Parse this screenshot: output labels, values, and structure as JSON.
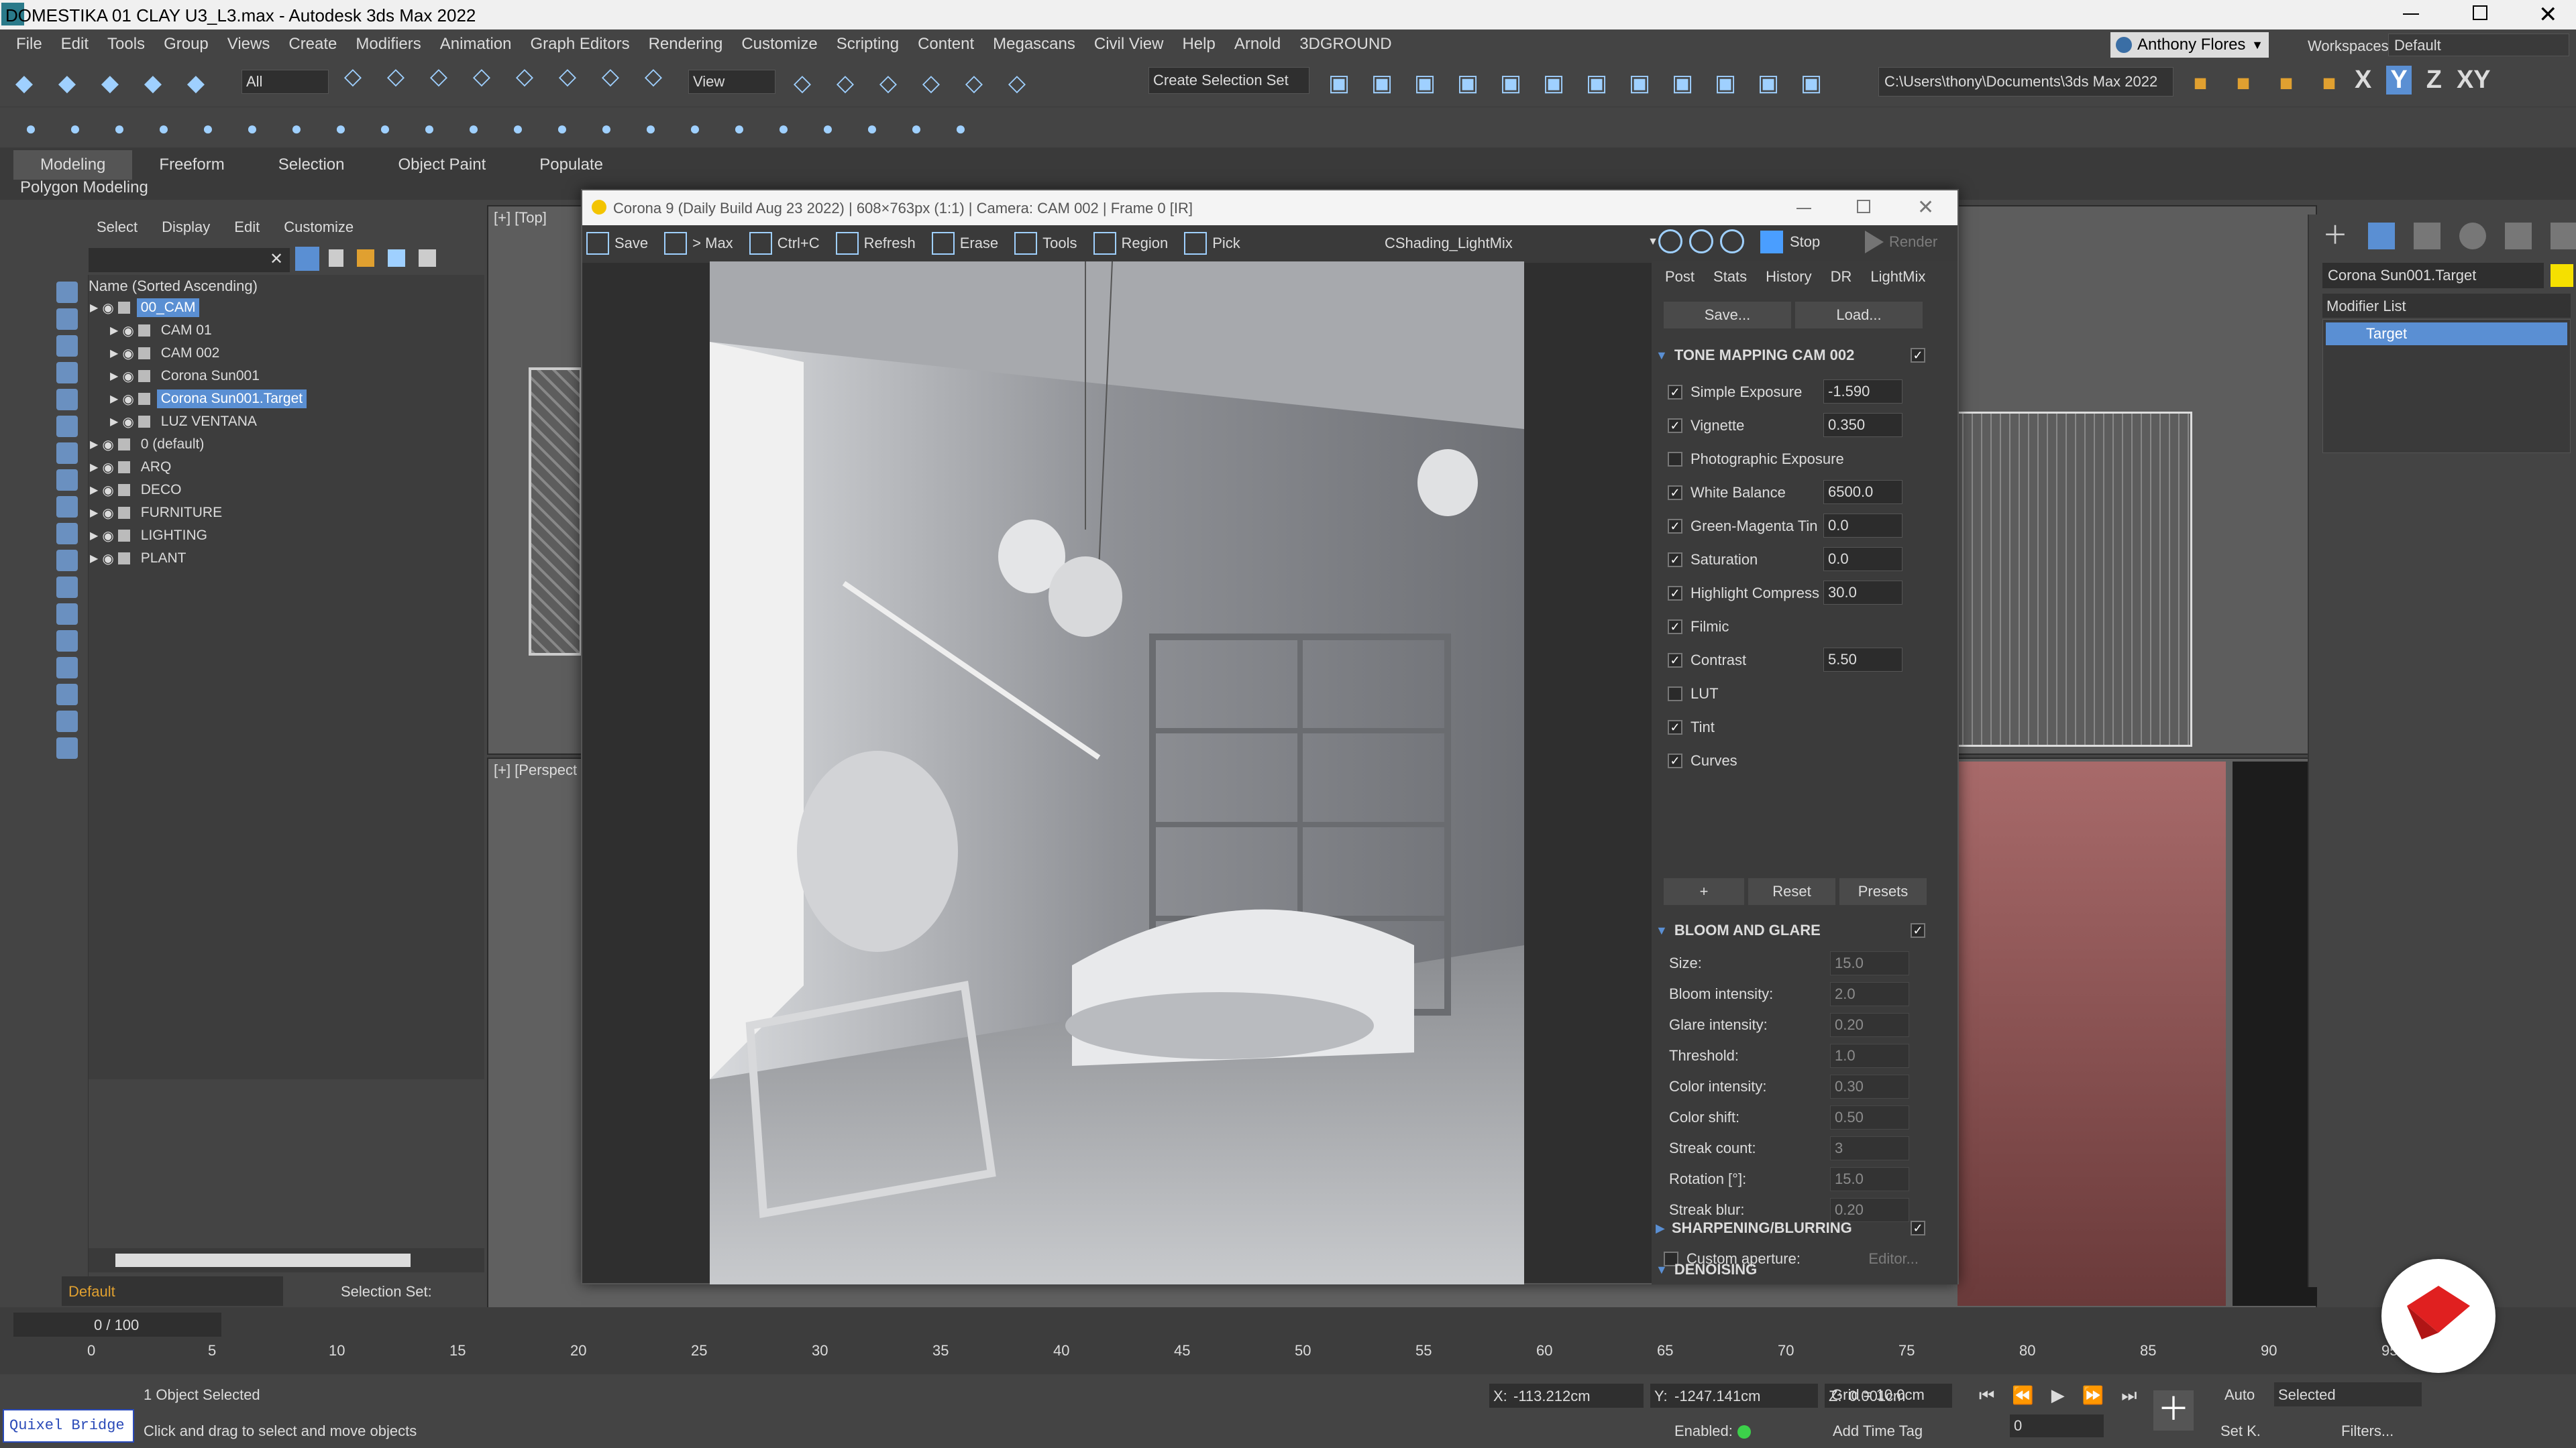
{
  "window": {
    "title": "DOMESTIKA 01 CLAY U3_L3.max - Autodesk 3ds Max 2022"
  },
  "menu": [
    "File",
    "Edit",
    "Tools",
    "Group",
    "Views",
    "Create",
    "Modifiers",
    "Animation",
    "Graph Editors",
    "Rendering",
    "Customize",
    "Scripting",
    "Content",
    "Megascans",
    "Civil View",
    "Help",
    "Arnold",
    "3DGROUND"
  ],
  "user": {
    "name": "Anthony Flores",
    "workspaces_label": "Workspaces:",
    "workspace": "Default"
  },
  "toolbar": {
    "filter_value": "All",
    "view_value": "View",
    "selection_set": "Create Selection Set",
    "path": "C:\\Users\\thony\\Documents\\3ds Max 2022",
    "axes": [
      "X",
      "Y",
      "Z",
      "XY"
    ]
  },
  "ribbon": {
    "tabs": [
      "Modeling",
      "Freeform",
      "Selection",
      "Object Paint",
      "Populate"
    ],
    "sub": "Polygon Modeling"
  },
  "scene_explorer": {
    "menu": [
      "Select",
      "Display",
      "Edit",
      "Customize"
    ],
    "header": "Name (Sorted Ascending)",
    "items": [
      {
        "label": "00_CAM",
        "indent": 0,
        "selected": true
      },
      {
        "label": "CAM 01",
        "indent": 1
      },
      {
        "label": "CAM 002",
        "indent": 1
      },
      {
        "label": "Corona Sun001",
        "indent": 1
      },
      {
        "label": "Corona Sun001.Target",
        "indent": 1,
        "selected": true
      },
      {
        "label": "LUZ VENTANA",
        "indent": 1
      },
      {
        "label": "0 (default)",
        "indent": 0
      },
      {
        "label": "ARQ",
        "indent": 0
      },
      {
        "label": "DECO",
        "indent": 0
      },
      {
        "label": "FURNITURE",
        "indent": 0
      },
      {
        "label": "LIGHTING",
        "indent": 0
      },
      {
        "label": "PLANT",
        "indent": 0
      }
    ],
    "layer": "Default",
    "selection_set_label": "Selection Set:"
  },
  "viewports": {
    "top_label": "[+] [Top]",
    "persp_label": "[+] [Perspect"
  },
  "vfb": {
    "title": "Corona 9 (Daily Build Aug 23 2022) | 608×763px (1:1) | Camera: CAM 002 | Frame 0 [IR]",
    "tools": [
      "Save",
      "> Max",
      "Ctrl+C",
      "Refresh",
      "Erase",
      "Tools",
      "Region",
      "Pick"
    ],
    "channel": "CShading_LightMix",
    "stop": "Stop",
    "render": "Render",
    "tabs": [
      "Post",
      "Stats",
      "History",
      "DR",
      "LightMix"
    ],
    "save_btn": "Save...",
    "load_btn": "Load...",
    "tone_header": "TONE MAPPING CAM 002",
    "tone_rows": [
      {
        "label": "Simple Exposure",
        "checked": true,
        "value": "-1.590"
      },
      {
        "label": "Vignette",
        "checked": true,
        "value": "0.350"
      },
      {
        "label": "Photographic Exposure",
        "checked": false,
        "value": ""
      },
      {
        "label": "White Balance",
        "checked": true,
        "value": "6500.0"
      },
      {
        "label": "Green-Magenta Tin",
        "checked": true,
        "value": "0.0"
      },
      {
        "label": "Saturation",
        "checked": true,
        "value": "0.0"
      },
      {
        "label": "Highlight Compress",
        "checked": true,
        "value": "30.0"
      },
      {
        "label": "Filmic",
        "checked": true,
        "value": ""
      },
      {
        "label": "Contrast",
        "checked": true,
        "value": "5.50"
      },
      {
        "label": "LUT",
        "checked": false,
        "value": ""
      },
      {
        "label": "Tint",
        "checked": true,
        "value": ""
      },
      {
        "label": "Curves",
        "checked": true,
        "value": ""
      }
    ],
    "add_btn": "+",
    "reset_btn": "Reset",
    "presets_btn": "Presets",
    "bloom_header": "BLOOM AND GLARE",
    "bloom_rows": [
      {
        "label": "Size:",
        "value": "15.0"
      },
      {
        "label": "Bloom intensity:",
        "value": "2.0"
      },
      {
        "label": "Glare intensity:",
        "value": "0.20"
      },
      {
        "label": "Threshold:",
        "value": "1.0"
      },
      {
        "label": "Color intensity:",
        "value": "0.30"
      },
      {
        "label": "Color shift:",
        "value": "0.50"
      },
      {
        "label": "Streak count:",
        "value": "3"
      },
      {
        "label": "Rotation [°]:",
        "value": "15.0"
      },
      {
        "label": "Streak blur:",
        "value": "0.20"
      }
    ],
    "custom_aperture": "Custom aperture:",
    "editor_btn": "Editor...",
    "sharpen_header": "SHARPENING/BLURRING",
    "denoise_header": "DENOISING"
  },
  "command_panel": {
    "object_name": "Corona Sun001.Target",
    "modifier_list": "Modifier List",
    "stack_item": "Target"
  },
  "timeline": {
    "frame": "0 / 100",
    "ticks": [
      "0",
      "5",
      "10",
      "15",
      "20",
      "25",
      "30",
      "35",
      "40",
      "45",
      "50",
      "55",
      "60",
      "65",
      "70",
      "75",
      "80",
      "85",
      "90",
      "95"
    ]
  },
  "status": {
    "quixel": "Quixel Bridge",
    "selected": "1 Object Selected",
    "hint": "Click and drag to select and move objects",
    "x": "-113.212cm",
    "y": "-1247.141cm",
    "z": "0.001cm",
    "grid": "Grid = 10.0cm",
    "enabled": "Enabled:",
    "add_time_tag": "Add Time Tag",
    "auto": "Auto",
    "selected_dropdown": "Selected",
    "setk": "Set K.",
    "filters": "Filters...",
    "frame_field": "0"
  },
  "colors": {
    "accent": "#5a8fd3",
    "brand_red": "#e02020"
  }
}
